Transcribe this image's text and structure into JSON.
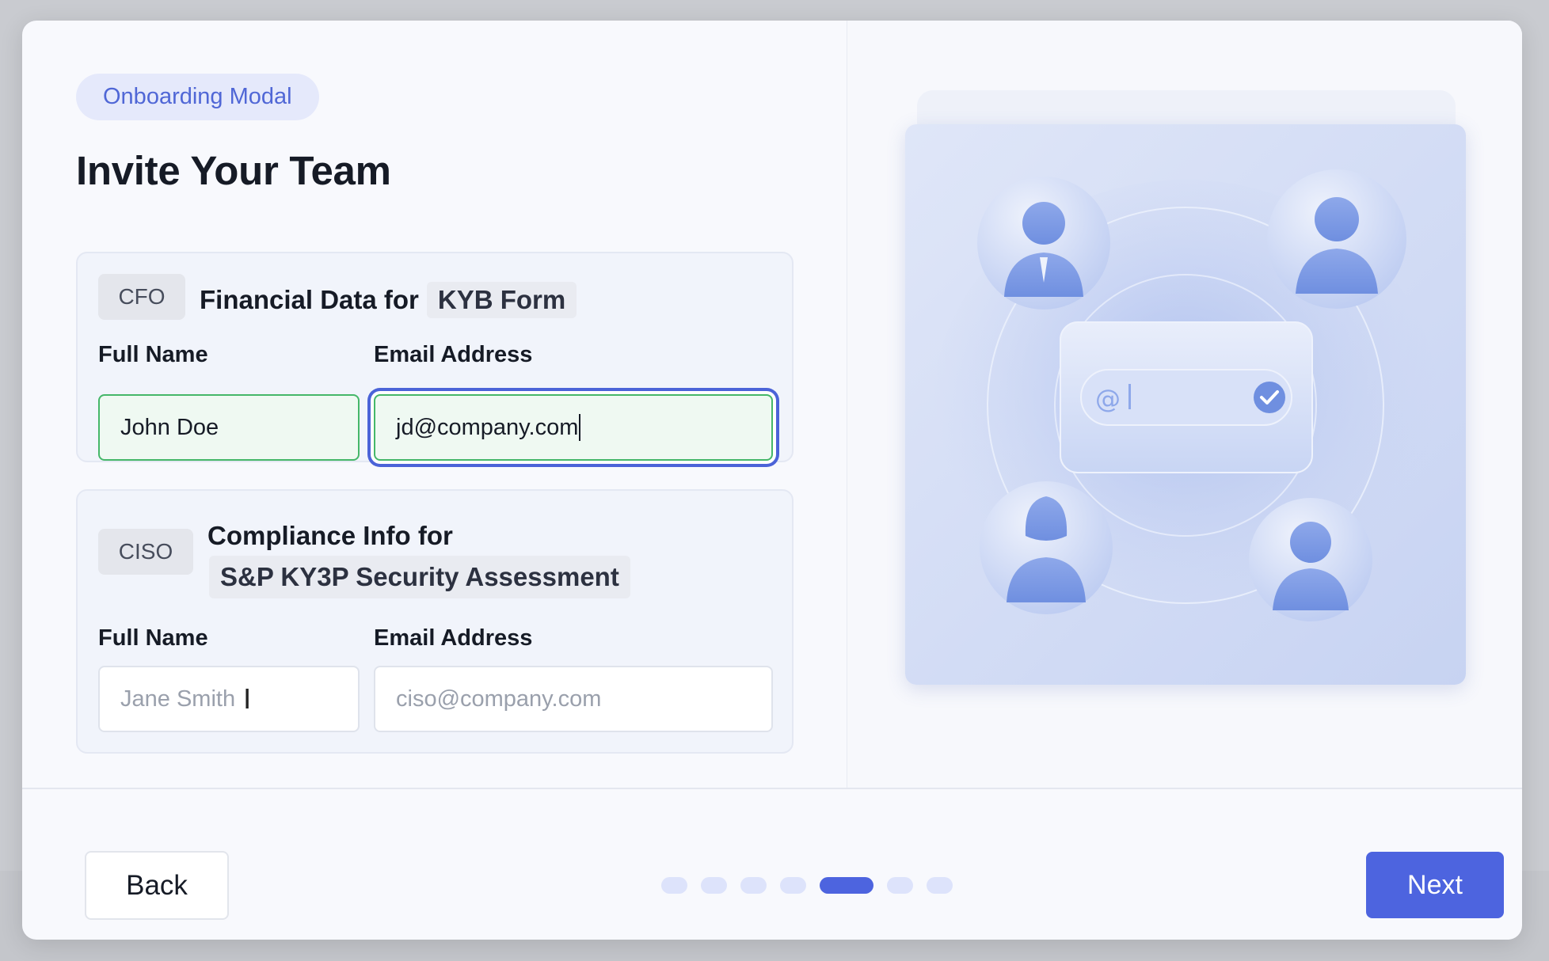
{
  "modal": {
    "tag": "Onboarding Modal",
    "title": "Invite Your Team"
  },
  "cards": [
    {
      "role": "CFO",
      "heading": "Financial Data for",
      "form_name": "KYB Form",
      "name_label": "Full Name",
      "name_value": "John Doe",
      "email_label": "Email Address",
      "email_value": "jd@company.com"
    },
    {
      "role": "CISO",
      "heading": "Compliance Info for",
      "form_name": "S&P KY3P Security Assessment",
      "name_label": "Full Name",
      "name_placeholder": "Jane Smith",
      "email_label": "Email Address",
      "email_placeholder": "ciso@company.com"
    }
  ],
  "illustration": {
    "icons": [
      "user-avatar-icon",
      "at-sign-icon",
      "check-circle-icon"
    ]
  },
  "footer": {
    "back_label": "Back",
    "next_label": "Next",
    "steps_total": 7,
    "steps_current": 5
  },
  "colors": {
    "accent": "#4d64df",
    "success_border": "#45b769",
    "pill_bg": "#e5e9fb"
  }
}
